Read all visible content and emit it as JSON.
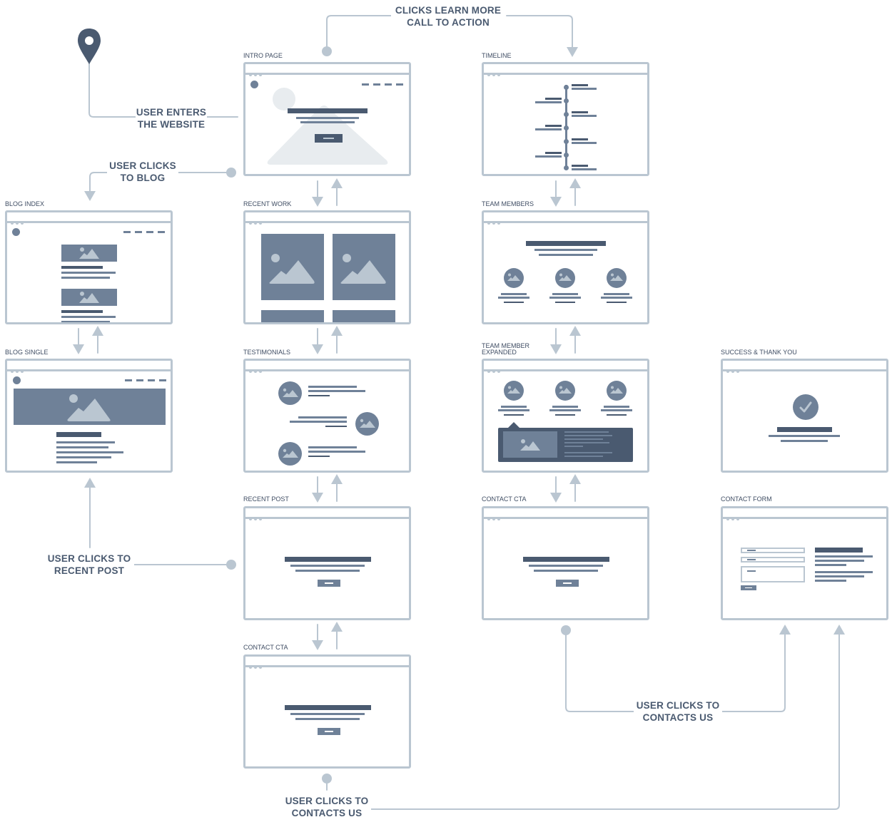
{
  "diagram": {
    "type": "website-user-flow-sitemap",
    "colors": {
      "connector": "#bac6d1",
      "dark": "#4a5a70",
      "medium": "#6f8198",
      "pale": "#e8ecef",
      "text": "#4a5a70"
    },
    "start_icon": "map-pin-icon",
    "screens": {
      "intro_page": {
        "title": "INTRO PAGE"
      },
      "timeline": {
        "title": "TIMELINE"
      },
      "blog_index": {
        "title": "BLOG INDEX"
      },
      "blog_single": {
        "title": "BLOG SINGLE"
      },
      "recent_work": {
        "title": "RECENT WORK"
      },
      "testimonials": {
        "title": "TESTIMONIALS"
      },
      "team_members": {
        "title": "TEAM MEMBERS"
      },
      "team_member_expanded": {
        "title": "TEAM MEMBER EXPANDED",
        "title_line1": "TEAM MEMBER",
        "title_line2": "EXPANDED"
      },
      "success_thank_you": {
        "title": "SUCCESS & THANK YOU"
      },
      "recent_post": {
        "title": "RECENT POST"
      },
      "contact_cta_left": {
        "title": "CONTACT CTA"
      },
      "contact_cta_right": {
        "title": "CONTACT CTA"
      },
      "contact_form": {
        "title": "CONTACT FORM"
      }
    },
    "flow_labels": {
      "learn_more": {
        "line1": "CLICKS LEARN MORE",
        "line2": "CALL TO ACTION"
      },
      "enters": {
        "line1": "USER ENTERS",
        "line2": "THE WEBSITE"
      },
      "to_blog": {
        "line1": "USER CLICKS",
        "line2": "TO BLOG"
      },
      "to_recent_post": {
        "line1": "USER CLICKS TO",
        "line2": "RECENT POST"
      },
      "contacts_right": {
        "line1": "USER CLICKS TO",
        "line2": "CONTACTS US"
      },
      "contacts_bottom": {
        "line1": "USER CLICKS TO",
        "line2": "CONTACTS US"
      }
    },
    "edges": [
      {
        "from": "start",
        "to": "intro_page",
        "label": "USER ENTERS THE WEBSITE"
      },
      {
        "from": "intro_page",
        "to": "timeline",
        "label": "CLICKS LEARN MORE CALL TO ACTION"
      },
      {
        "from": "intro_page",
        "to": "blog_index",
        "label": "USER CLICKS TO BLOG"
      },
      {
        "from": "intro_page",
        "to": "recent_work",
        "bidirectional": true
      },
      {
        "from": "recent_work",
        "to": "testimonials",
        "bidirectional": true
      },
      {
        "from": "testimonials",
        "to": "recent_post",
        "bidirectional": true
      },
      {
        "from": "recent_post",
        "to": "contact_cta_left",
        "bidirectional": true
      },
      {
        "from": "blog_index",
        "to": "blog_single",
        "bidirectional": true
      },
      {
        "from": "recent_post",
        "to": "blog_single",
        "label": "USER CLICKS TO RECENT POST"
      },
      {
        "from": "timeline",
        "to": "team_members",
        "bidirectional": true
      },
      {
        "from": "team_members",
        "to": "team_member_expanded",
        "bidirectional": true
      },
      {
        "from": "team_member_expanded",
        "to": "contact_cta_right",
        "bidirectional": true
      },
      {
        "from": "contact_cta_right",
        "to": "contact_form",
        "label": "USER CLICKS TO CONTACTS US"
      },
      {
        "from": "contact_cta_left",
        "to": "contact_form",
        "label": "USER CLICKS TO CONTACTS US"
      }
    ]
  }
}
